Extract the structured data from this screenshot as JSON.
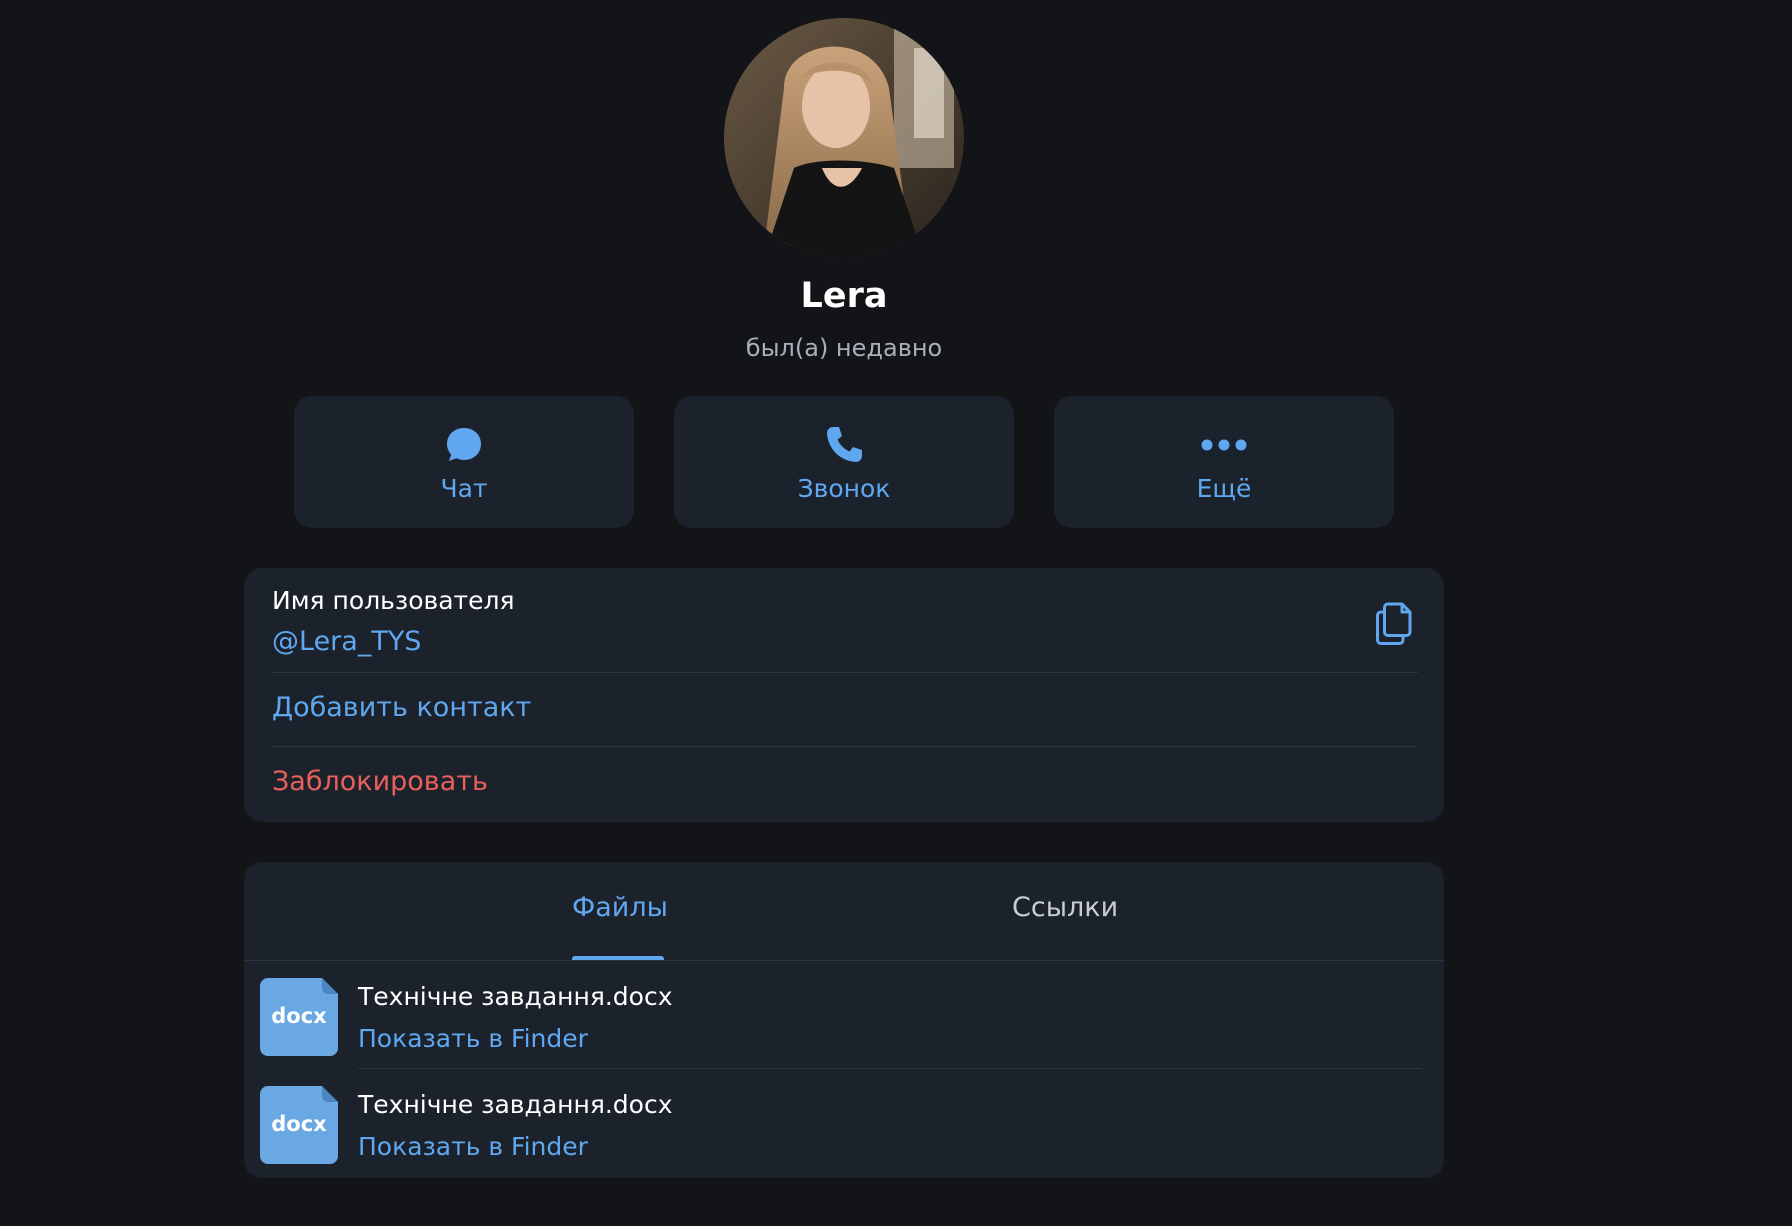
{
  "profile": {
    "name": "Lera",
    "status": "был(а) недавно"
  },
  "actions": [
    {
      "label": "Чат",
      "icon": "chat-bubble-icon"
    },
    {
      "label": "Звонок",
      "icon": "phone-icon"
    },
    {
      "label": "Ещё",
      "icon": "more-dots-icon"
    }
  ],
  "info": {
    "username_label": "Имя пользователя",
    "username_value": "@Lera_TYS",
    "copy_icon": "copy-icon",
    "add_contact_label": "Добавить контакт",
    "block_label": "Заблокировать"
  },
  "media": {
    "tabs": [
      {
        "label": "Файлы",
        "active": true
      },
      {
        "label": "Ссылки",
        "active": false
      }
    ],
    "files": [
      {
        "ext": "docx",
        "name": "Технічне завдання.docx",
        "action": "Показать в Finder"
      },
      {
        "ext": "docx",
        "name": "Технічне завдання.docx",
        "action": "Показать в Finder"
      }
    ]
  },
  "colors": {
    "background": "#121417",
    "card": "#1c222c",
    "accent": "#5fa8f0",
    "danger": "#e8605a",
    "muted": "#a9b0ba",
    "file_icon": "#6aa8e3"
  }
}
